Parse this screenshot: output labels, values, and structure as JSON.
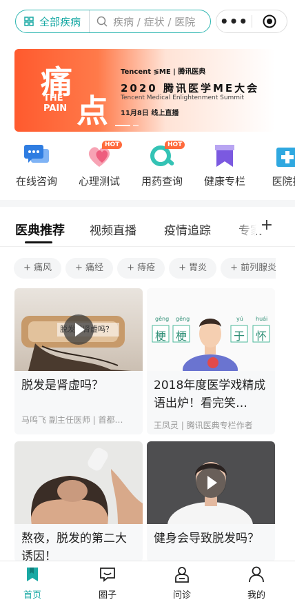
{
  "search": {
    "category_label": "全部疾病",
    "placeholder": "疾病 / 症状 / 医院"
  },
  "capsule": {
    "more": "•••"
  },
  "banner": {
    "big_char_1": "痛",
    "big_char_2": "点",
    "english": "THE PAIN",
    "brand": "Tencent  ≶ME | 腾讯医典",
    "title": "2020 腾讯医学ME大会",
    "subtitle": "Tencent Medical Enlightenment Summit",
    "date": "11月8日  线上直播"
  },
  "quick_entries": [
    {
      "label": "在线咨询",
      "icon": "chat-bubbles-icon"
    },
    {
      "label": "心理测试",
      "icon": "heart-icon",
      "badge": "HOT"
    },
    {
      "label": "用药查询",
      "icon": "pill-search-icon",
      "badge": "HOT"
    },
    {
      "label": "健康专栏",
      "icon": "bookmark-icon"
    },
    {
      "label": "医院指",
      "icon": "hospital-icon"
    }
  ],
  "tabs": [
    "医典推荐",
    "视频直播",
    "疫情追踪",
    "专家"
  ],
  "tab_plus": "+",
  "chips": [
    "+ 痛风",
    "+ 痛经",
    "+ 痔疮",
    "+ 胃炎",
    "+ 前列腺炎"
  ],
  "cards": [
    {
      "title": "脱发是肾虚吗？",
      "meta": "马鸣飞 副主任医师 | 首都…",
      "video": true,
      "overlay_text": "脱发是肾虚吗？"
    },
    {
      "title": "2018年度医学戏精成语出炉！看完笑…",
      "meta": "王凤灵 | 腾讯医典专栏作者",
      "video": false,
      "pinyin": [
        "gěng",
        "gěng",
        "yú",
        "huái"
      ],
      "chars": [
        "梗",
        "梗",
        "于",
        "怀"
      ]
    },
    {
      "title": "熬夜，脱发的第二大诱因！",
      "meta": "",
      "video": false
    },
    {
      "title": "健身会导致脱发吗？",
      "meta": "",
      "video": true
    }
  ],
  "bottom_nav": [
    {
      "label": "首页",
      "icon": "home-bookmark-icon",
      "active": true
    },
    {
      "label": "圈子",
      "icon": "message-square-icon",
      "active": false
    },
    {
      "label": "问诊",
      "icon": "doctor-icon",
      "active": false
    },
    {
      "label": "我的",
      "icon": "user-icon",
      "active": false
    }
  ],
  "colors": {
    "accent": "#19a9a4",
    "banner": "#ff5a2e",
    "hot": "#ff6a3c"
  }
}
